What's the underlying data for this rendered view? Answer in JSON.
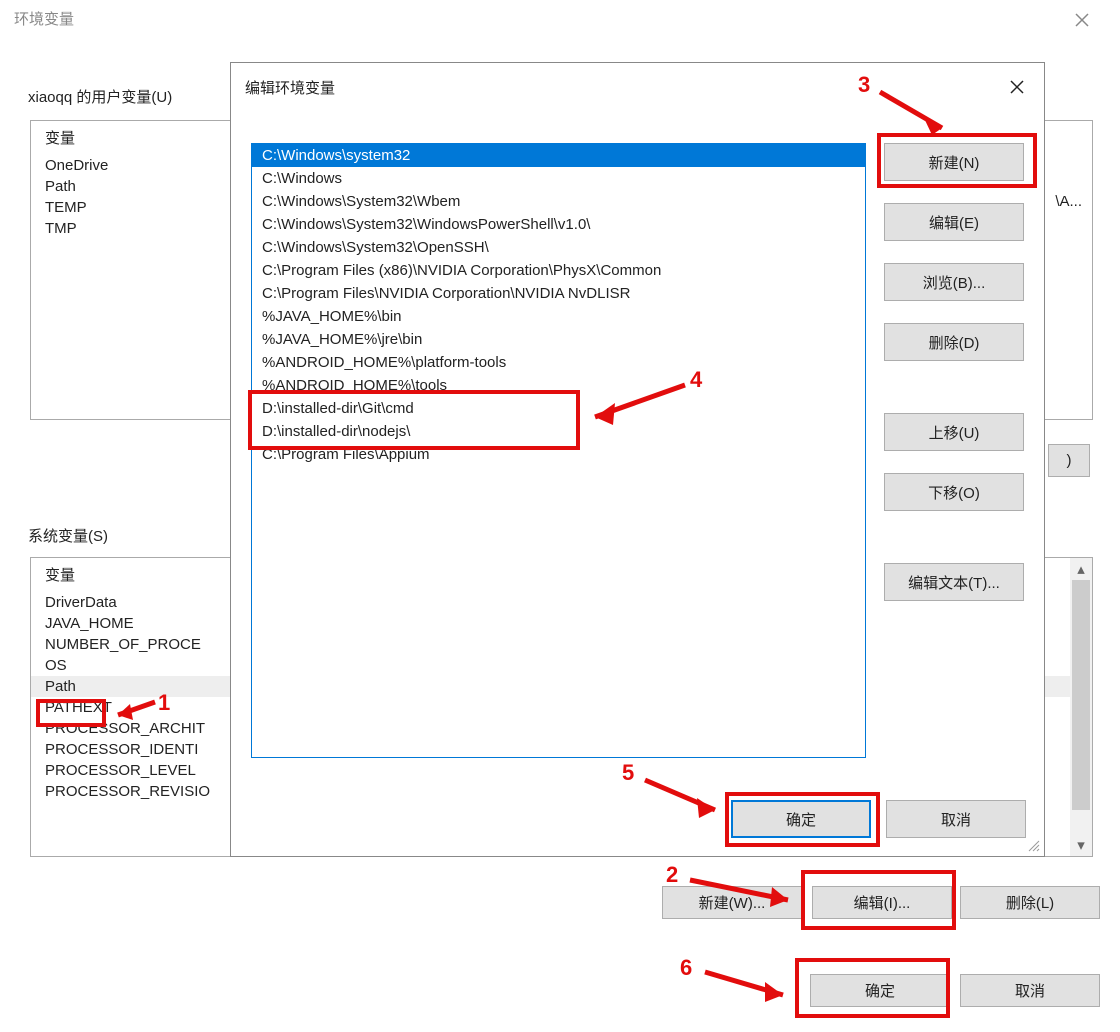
{
  "outer": {
    "title": "环境变量",
    "user_vars_label": "xiaoqq 的用户变量(U)",
    "sys_vars_label": "系统变量(S)",
    "col_var": "变量",
    "user_items": [
      "OneDrive",
      "Path",
      "TEMP",
      "TMP"
    ],
    "user_value_peek": "\\A...",
    "sys_items": [
      "DriverData",
      "JAVA_HOME",
      "NUMBER_OF_PROCE",
      "OS",
      "Path",
      "PATHEXT",
      "PROCESSOR_ARCHIT",
      "PROCESSOR_IDENTI",
      "PROCESSOR_LEVEL",
      "PROCESSOR_REVISIO"
    ],
    "sys_selected_index": 4,
    "btn_new_w": "新建(W)...",
    "btn_edit_i": "编辑(I)...",
    "btn_del_l": "删除(L)",
    "btn_ok": "确定",
    "btn_cancel": "取消",
    "partial_btn": ")"
  },
  "edit": {
    "title": "编辑环境变量",
    "items": [
      "C:\\Windows\\system32",
      "C:\\Windows",
      "C:\\Windows\\System32\\Wbem",
      "C:\\Windows\\System32\\WindowsPowerShell\\v1.0\\",
      "C:\\Windows\\System32\\OpenSSH\\",
      "C:\\Program Files (x86)\\NVIDIA Corporation\\PhysX\\Common",
      "C:\\Program Files\\NVIDIA Corporation\\NVIDIA NvDLISR",
      "%JAVA_HOME%\\bin",
      "%JAVA_HOME%\\jre\\bin",
      "%ANDROID_HOME%\\platform-tools",
      "%ANDROID_HOME%\\tools",
      "D:\\installed-dir\\Git\\cmd",
      "D:\\installed-dir\\nodejs\\",
      "C:\\Program Files\\Appium"
    ],
    "selected_index": 0,
    "btn_new": "新建(N)",
    "btn_edit": "编辑(E)",
    "btn_browse": "浏览(B)...",
    "btn_delete": "删除(D)",
    "btn_up": "上移(U)",
    "btn_down": "下移(O)",
    "btn_text": "编辑文本(T)...",
    "btn_ok": "确定",
    "btn_cancel": "取消"
  },
  "anno": {
    "n1": "1",
    "n2": "2",
    "n3": "3",
    "n4": "4",
    "n5": "5",
    "n6": "6"
  }
}
